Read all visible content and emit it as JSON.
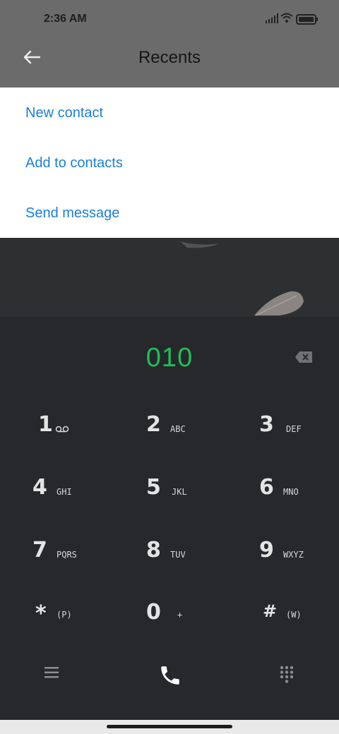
{
  "status_bar": {
    "time": "2:36 AM"
  },
  "header": {
    "title": "Recents"
  },
  "menu": {
    "items": [
      {
        "label": "New contact"
      },
      {
        "label": "Add to contacts"
      },
      {
        "label": "Send message"
      }
    ]
  },
  "dialer": {
    "entered_number": "010",
    "keys": [
      {
        "digit": "1",
        "letters": ""
      },
      {
        "digit": "2",
        "letters": "ABC"
      },
      {
        "digit": "3",
        "letters": "DEF"
      },
      {
        "digit": "4",
        "letters": "GHI"
      },
      {
        "digit": "5",
        "letters": "JKL"
      },
      {
        "digit": "6",
        "letters": "MNO"
      },
      {
        "digit": "7",
        "letters": "PQRS"
      },
      {
        "digit": "8",
        "letters": "TUV"
      },
      {
        "digit": "9",
        "letters": "WXYZ"
      },
      {
        "digit": "*",
        "letters": "(P)"
      },
      {
        "digit": "0",
        "letters": "+"
      },
      {
        "digit": "#",
        "letters": "(W)"
      }
    ]
  },
  "colors": {
    "number_green": "#1fbf55",
    "menu_blue": "#1a7fd9"
  },
  "icons": [
    "back-arrow-icon",
    "signal-icon",
    "wifi-icon",
    "battery-icon",
    "backspace-icon",
    "voicemail-icon",
    "menu-icon",
    "phone-icon",
    "dialpad-icon"
  ]
}
